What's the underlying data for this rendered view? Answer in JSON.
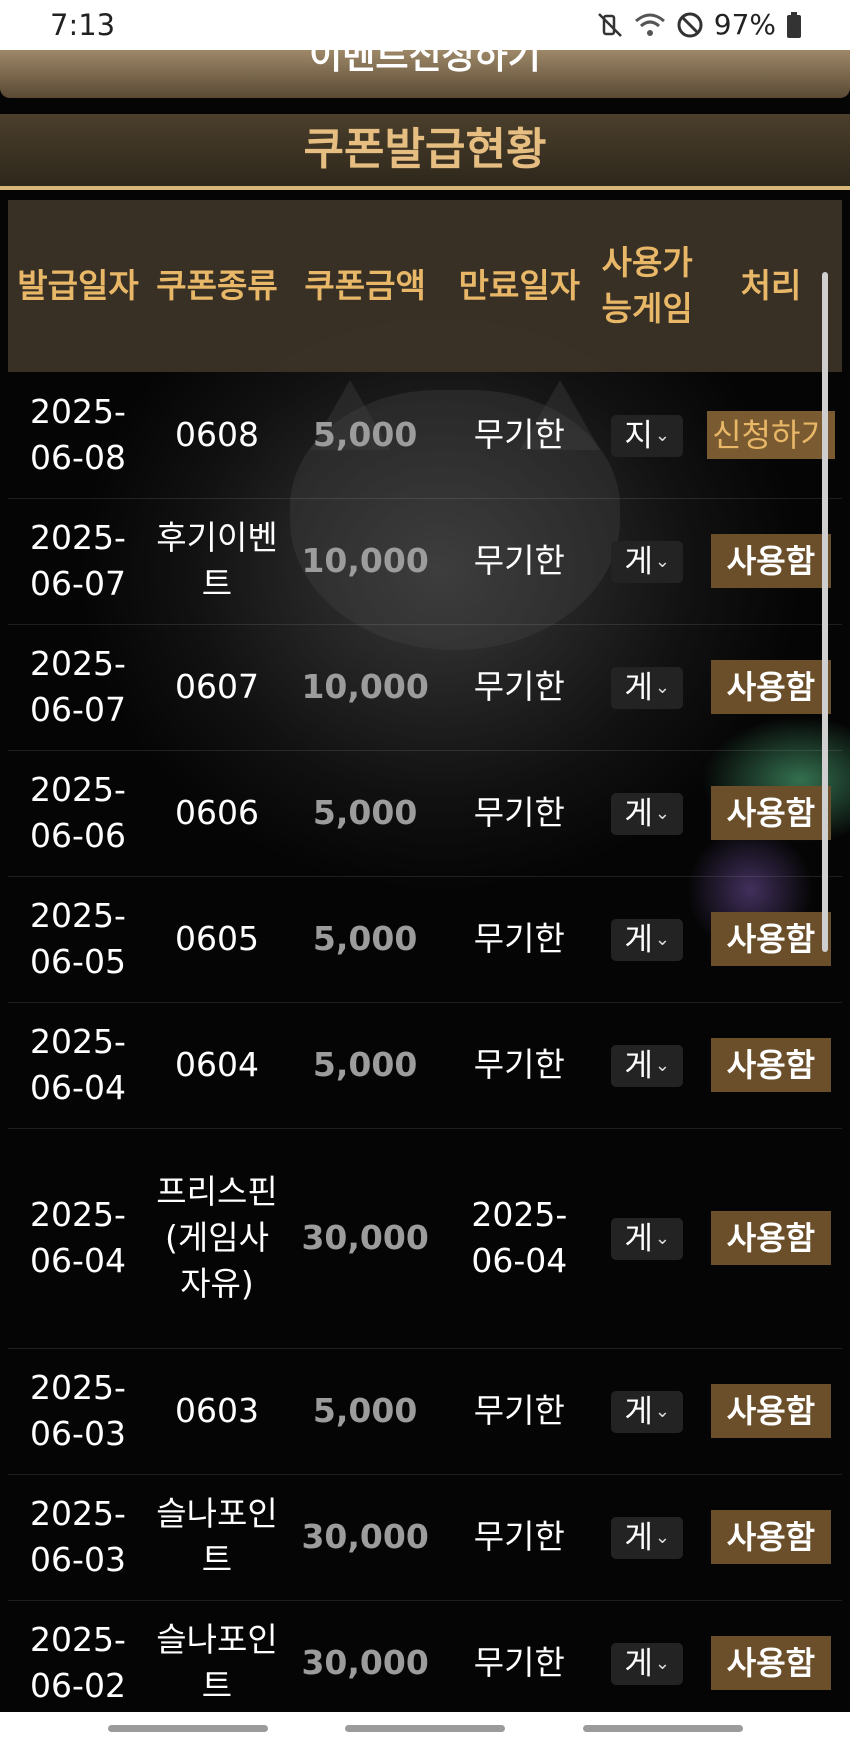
{
  "status": {
    "time": "7:13",
    "battery": "97%"
  },
  "event_button_label": "이벤트신청하기",
  "section_title": "쿠폰발급현황",
  "table": {
    "headers": {
      "date": "발급일자",
      "type": "쿠폰종류",
      "amount": "쿠폰금액",
      "expiry": "만료일자",
      "game": "사용가능게임",
      "action": "처리"
    },
    "rows": [
      {
        "date": "2025-06-08",
        "type": "0608",
        "amount": "5,000",
        "expiry": "무기한",
        "game": "지",
        "action": "신청하기"
      },
      {
        "date": "2025-06-07",
        "type": "후기이벤트",
        "amount": "10,000",
        "expiry": "무기한",
        "game": "게",
        "action": "사용함"
      },
      {
        "date": "2025-06-07",
        "type": "0607",
        "amount": "10,000",
        "expiry": "무기한",
        "game": "게",
        "action": "사용함"
      },
      {
        "date": "2025-06-06",
        "type": "0606",
        "amount": "5,000",
        "expiry": "무기한",
        "game": "게",
        "action": "사용함"
      },
      {
        "date": "2025-06-05",
        "type": "0605",
        "amount": "5,000",
        "expiry": "무기한",
        "game": "게",
        "action": "사용함"
      },
      {
        "date": "2025-06-04",
        "type": "0604",
        "amount": "5,000",
        "expiry": "무기한",
        "game": "게",
        "action": "사용함"
      },
      {
        "date": "2025-06-04",
        "type": "프리스핀 (게임사자유)",
        "amount": "30,000",
        "expiry": "2025-06-04",
        "game": "게",
        "action": "사용함"
      },
      {
        "date": "2025-06-03",
        "type": "0603",
        "amount": "5,000",
        "expiry": "무기한",
        "game": "게",
        "action": "사용함"
      },
      {
        "date": "2025-06-03",
        "type": "슬나포인트",
        "amount": "30,000",
        "expiry": "무기한",
        "game": "게",
        "action": "사용함"
      },
      {
        "date": "2025-06-02",
        "type": "슬나포인트",
        "amount": "30,000",
        "expiry": "무기한",
        "game": "게",
        "action": "사용함"
      }
    ]
  }
}
